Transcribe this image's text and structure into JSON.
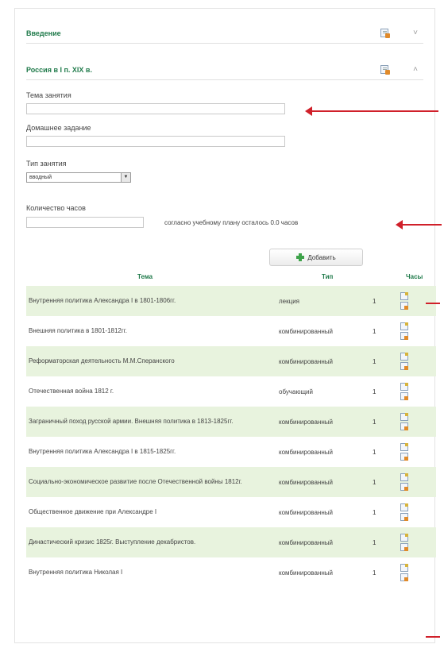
{
  "sections": [
    {
      "title": "Введение",
      "chevron": "˅"
    },
    {
      "title": "Россия в I п. XIX в.",
      "chevron": "˄"
    }
  ],
  "form": {
    "topic_label": "Тема занятия",
    "topic_value": "",
    "homework_label": "Домашнее задание",
    "homework_value": "",
    "type_label": "Тип занятия",
    "type_value": "вводный",
    "hours_label": "Количество часов",
    "hours_value": "",
    "remaining_text": "согласно учебному плану осталось 0.0 часов",
    "add_button": "Добавить"
  },
  "table": {
    "headers": {
      "topic": "Тема",
      "type": "Тип",
      "hours": "Часы"
    },
    "rows": [
      {
        "topic": "Внутренняя политика Александра I в 1801-1806гг.",
        "type": "лекция",
        "hours": "1"
      },
      {
        "topic": "Внешняя политика в 1801-1812гг.",
        "type": "комбинированный",
        "hours": "1"
      },
      {
        "topic": "Реформаторская деятельность М.М.Сперанского",
        "type": "комбинированный",
        "hours": "1"
      },
      {
        "topic": "Отечественная война 1812 г.",
        "type": "обучающий",
        "hours": "1"
      },
      {
        "topic": "Заграничный поход русской армии. Внешняя политика в 1813-1825гг.",
        "type": "комбинированный",
        "hours": "1"
      },
      {
        "topic": "Внутренняя политика Александра I в 1815-1825гг.",
        "type": "комбинированный",
        "hours": "1"
      },
      {
        "topic": "Социально-экономическое развитие после Отечественной войны 1812г.",
        "type": "комбинированный",
        "hours": "1"
      },
      {
        "topic": "Общественное движение при Александре I",
        "type": "комбинированный",
        "hours": "1"
      },
      {
        "topic": "Династический кризис 1825г. Выступление декабристов.",
        "type": "комбинированный",
        "hours": "1"
      },
      {
        "topic": "Внутренняя политика Николая I",
        "type": "комбинированный",
        "hours": "1"
      }
    ]
  },
  "colors": {
    "accent": "#1f7a4a",
    "row_alt": "#e8f3de",
    "arrow": "#d0202a"
  }
}
